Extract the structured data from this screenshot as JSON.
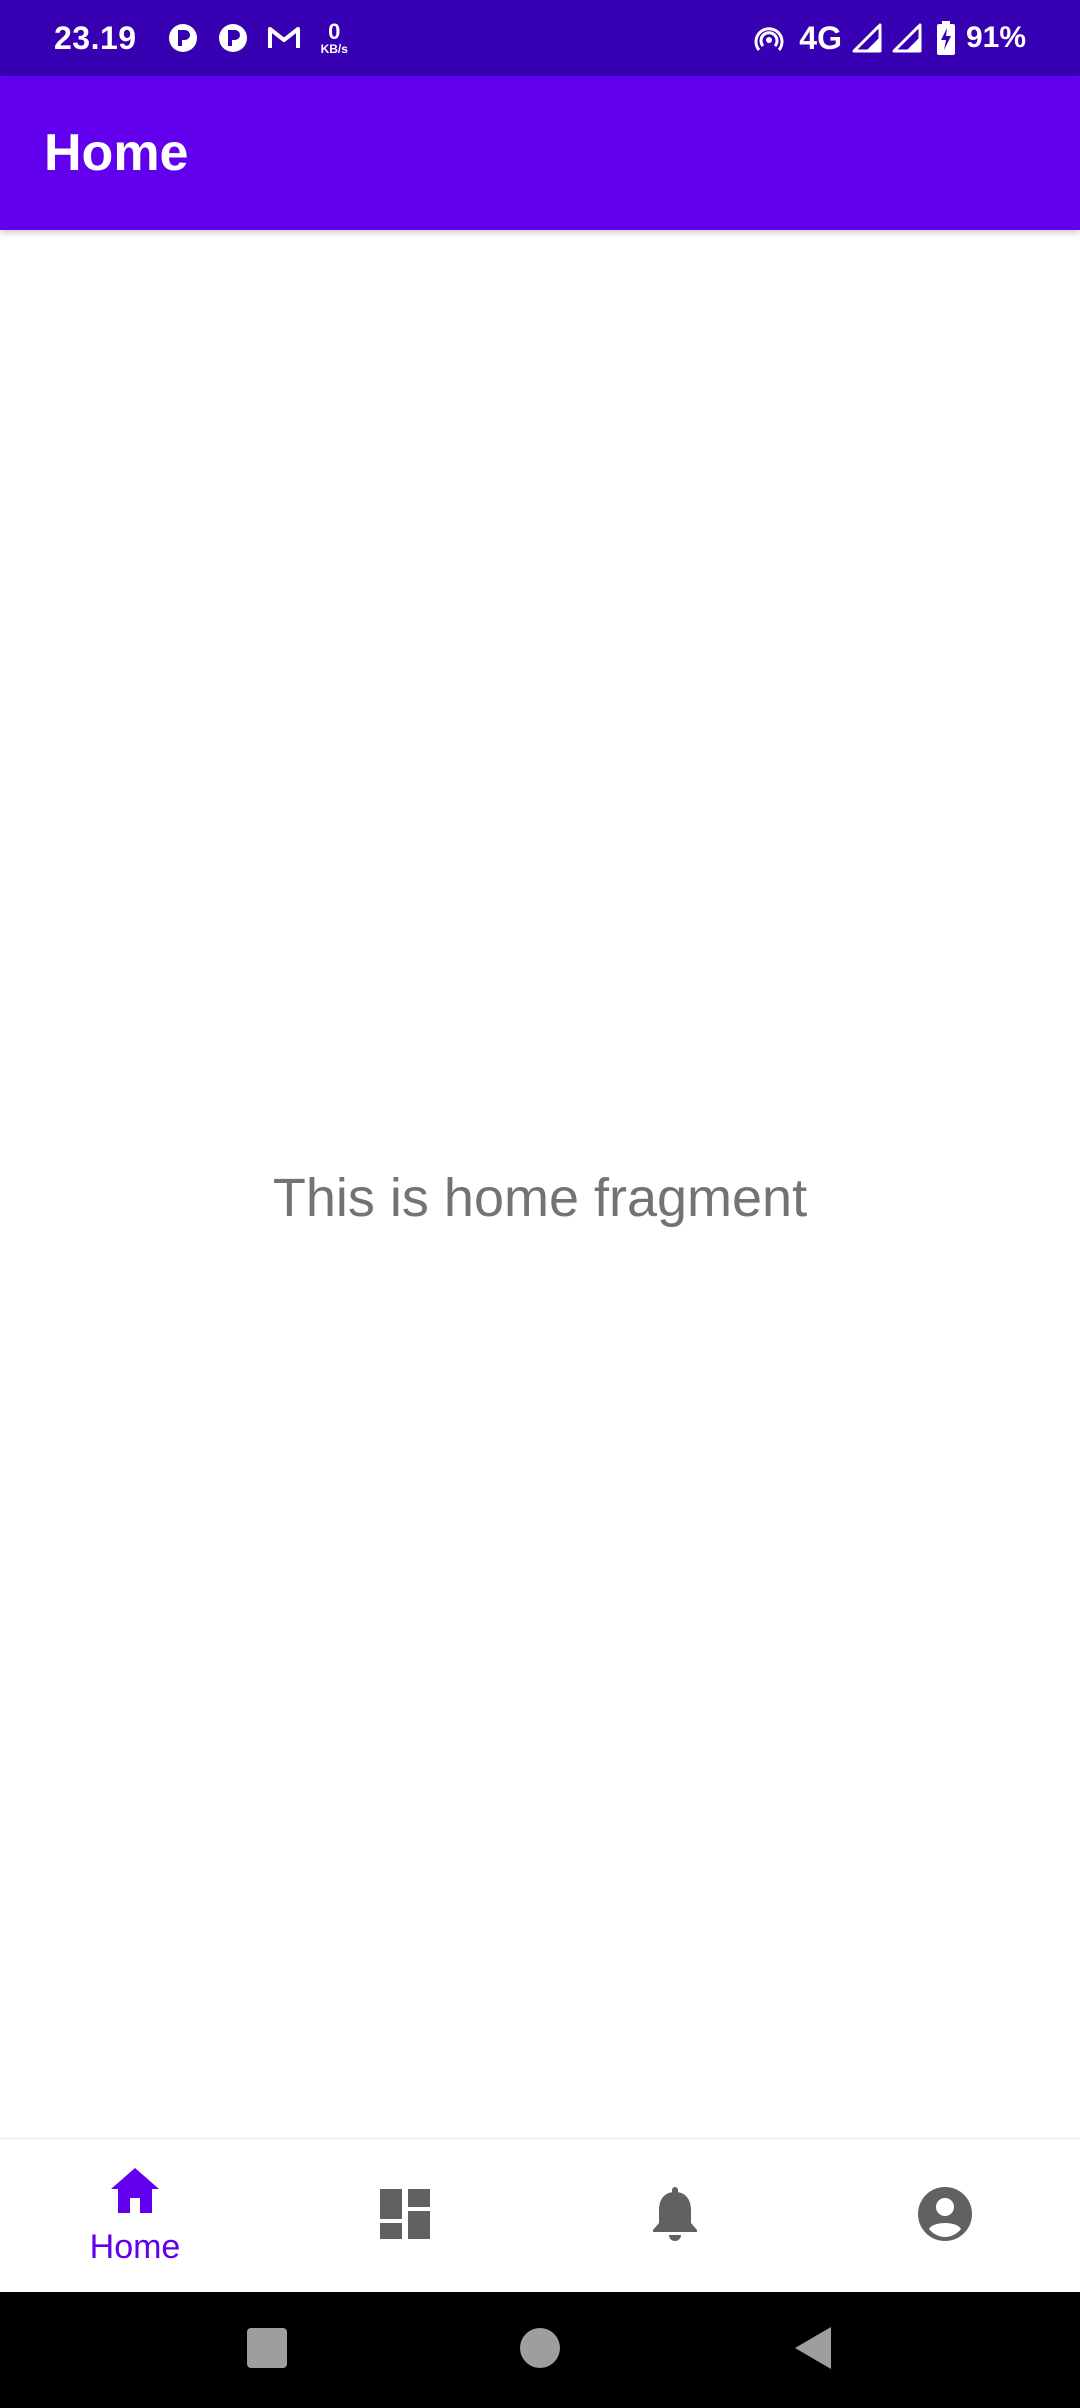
{
  "status_bar": {
    "time": "23.19",
    "speed_value": "0",
    "speed_unit": "KB/s",
    "network": "4G",
    "battery": "91%"
  },
  "app_bar": {
    "title": "Home"
  },
  "content": {
    "text": "This is home fragment"
  },
  "bottom_nav": {
    "items": [
      {
        "label": "Home",
        "icon": "home-icon",
        "selected": true
      },
      {
        "label": "",
        "icon": "dashboard-icon",
        "selected": false
      },
      {
        "label": "",
        "icon": "bell-icon",
        "selected": false
      },
      {
        "label": "",
        "icon": "account-icon",
        "selected": false
      }
    ],
    "active_color": "#6200ee",
    "inactive_color": "#616161"
  },
  "colors": {
    "status_bar": "#3700b3",
    "app_bar": "#6200ee"
  }
}
